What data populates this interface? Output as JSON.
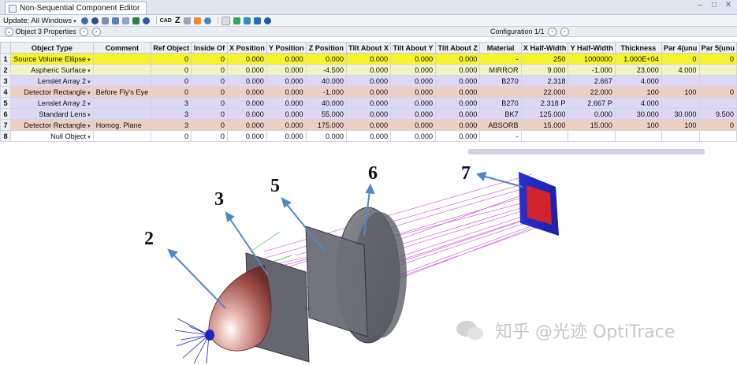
{
  "window": {
    "tab_title": "Non-Sequential Component Editor"
  },
  "toolbar": {
    "update_label": "Update: All Windows",
    "icons": [
      "refresh-icon",
      "refresh-all-icon",
      "settings-icon",
      "layout-icon",
      "shaded-icon",
      "viewer-icon",
      "cad-icon",
      "zemax-z-icon",
      "stop-icon",
      "reverse-icon",
      "page-icon",
      "swap-icon",
      "arrows-icon",
      "go-icon",
      "help-icon"
    ],
    "cad_label": "CAD",
    "z_label": "Z"
  },
  "props_bar": {
    "object_label": "Object 3 Properties",
    "configuration_label": "Configuration 1/1"
  },
  "table": {
    "headers": [
      "Object Type",
      "Comment",
      "Ref Object",
      "Inside Of",
      "X Position",
      "Y Position",
      "Z Position",
      "Tilt About X",
      "Tilt About Y",
      "Tilt About Z",
      "Material",
      "X Half-Width",
      "Y Half-Width",
      "Thickness",
      "Par 4(unu",
      "Par 5(unu"
    ],
    "rows": [
      {
        "n": "1",
        "type": "Source Volume Ellipse",
        "comment": "",
        "ref": "0",
        "inside": "0",
        "x": "0.000",
        "y": "0.000",
        "z": "0.000",
        "tx": "0.000",
        "ty": "0.000",
        "tz": "0.000",
        "mat": "-",
        "xh": "250",
        "yh": "1000000",
        "th": "1.000E+04",
        "p4": "0",
        "p5": "0"
      },
      {
        "n": "2",
        "type": "Aspheric Surface",
        "comment": "",
        "ref": "0",
        "inside": "0",
        "x": "0.000",
        "y": "0.000",
        "z": "-4.500",
        "tx": "0.000",
        "ty": "0.000",
        "tz": "0.000",
        "mat": "MIRROR",
        "xh": "9.000",
        "yh": "-1.000",
        "th": "23.000",
        "p4": "4.000",
        "p5": ""
      },
      {
        "n": "3",
        "type": "Lenslet Array 2",
        "comment": "",
        "ref": "0",
        "inside": "0",
        "x": "0.000",
        "y": "0.000",
        "z": "40.000",
        "tx": "0.000",
        "ty": "0.000",
        "tz": "0.000",
        "mat": "B270",
        "xh": "2.318",
        "yh": "2.667",
        "th": "4.000",
        "p4": "",
        "p5": ""
      },
      {
        "n": "4",
        "type": "Detector Rectangle",
        "comment": "Before Fly's Eye",
        "ref": "0",
        "inside": "0",
        "x": "0.000",
        "y": "0.000",
        "z": "-1.000",
        "tx": "0.000",
        "ty": "0.000",
        "tz": "0.000",
        "mat": "",
        "xh": "22.000",
        "yh": "22.000",
        "th": "100",
        "p4": "100",
        "p5": "0"
      },
      {
        "n": "5",
        "type": "Lenslet Array 2",
        "comment": "",
        "ref": "3",
        "inside": "0",
        "x": "0.000",
        "y": "0.000",
        "z": "40.000",
        "tx": "0.000",
        "ty": "0.000",
        "tz": "0.000",
        "mat": "B270",
        "xh": "2.318 P",
        "yh": "2.667 P",
        "th": "4.000",
        "p4": "",
        "p5": ""
      },
      {
        "n": "6",
        "type": "Standard Lens",
        "comment": "",
        "ref": "3",
        "inside": "0",
        "x": "0.000",
        "y": "0.000",
        "z": "55.000",
        "tx": "0.000",
        "ty": "0.000",
        "tz": "0.000",
        "mat": "BK7",
        "xh": "125.000",
        "yh": "0.000",
        "th": "30.000",
        "p4": "30.000",
        "p5": "9.500"
      },
      {
        "n": "7",
        "type": "Detector Rectangle",
        "comment": "Homog. Plane",
        "ref": "3",
        "inside": "0",
        "x": "0.000",
        "y": "0.000",
        "z": "175.000",
        "tx": "0.000",
        "ty": "0.000",
        "tz": "0.000",
        "mat": "ABSORB",
        "xh": "15.000",
        "yh": "15.000",
        "th": "100",
        "p4": "100",
        "p5": "0"
      },
      {
        "n": "8",
        "type": "Null Object",
        "comment": "",
        "ref": "0",
        "inside": "0",
        "x": "0.000",
        "y": "0.000",
        "z": "0.000",
        "tx": "0.000",
        "ty": "0.000",
        "tz": "0.000",
        "mat": "-",
        "xh": "",
        "yh": "",
        "th": "",
        "p4": "",
        "p5": ""
      }
    ]
  },
  "callouts": [
    "2",
    "3",
    "5",
    "6",
    "7"
  ],
  "watermark": "知乎 @光迹 OptiTrace"
}
